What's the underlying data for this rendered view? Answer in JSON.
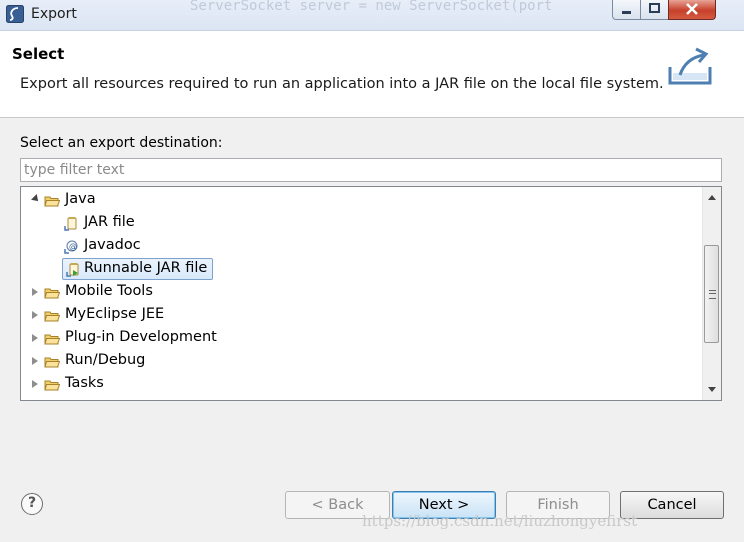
{
  "window": {
    "title": "Export",
    "background_code": "ServerSocket server = new ServerSocket(port"
  },
  "header": {
    "title": "Select",
    "description": "Export all resources required to run an application into a JAR file on the local file system."
  },
  "destination": {
    "label": "Select an export destination:",
    "filter_placeholder": "type filter text",
    "filter_value": ""
  },
  "tree": {
    "items": [
      {
        "label": "Java",
        "expanded": true,
        "icon": "folder-open-icon"
      },
      {
        "label": "JAR file",
        "icon": "jar-file-icon"
      },
      {
        "label": "Javadoc",
        "icon": "javadoc-icon"
      },
      {
        "label": "Runnable JAR file",
        "icon": "runnable-jar-icon",
        "selected": true
      },
      {
        "label": "Mobile Tools",
        "expanded": false,
        "icon": "folder-icon"
      },
      {
        "label": "MyEclipse JEE",
        "expanded": false,
        "icon": "folder-icon"
      },
      {
        "label": "Plug-in Development",
        "expanded": false,
        "icon": "folder-icon"
      },
      {
        "label": "Run/Debug",
        "expanded": false,
        "icon": "folder-icon"
      },
      {
        "label": "Tasks",
        "expanded": false,
        "icon": "folder-icon"
      }
    ]
  },
  "buttons": {
    "help": "?",
    "back": "< Back",
    "next": "Next >",
    "finish": "Finish",
    "cancel": "Cancel"
  },
  "watermark": "https://blog.csdn.net/liuzhongyefirst",
  "colors": {
    "selection": "#d9e9fb",
    "default_button_border": "#3c7fb1",
    "folder": "#e8b84a"
  }
}
